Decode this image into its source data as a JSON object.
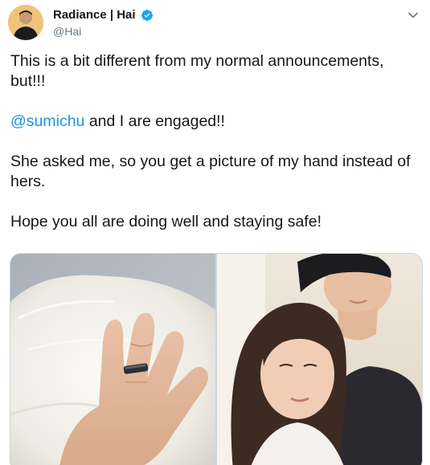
{
  "author": {
    "display_name": "Radiance | Hai",
    "handle": "@Hai",
    "verified": true,
    "avatar": "avatar-photo"
  },
  "tweet": {
    "paragraphs": [
      {
        "text": "This is a bit different from my normal announcements, but!!!"
      },
      {
        "mention": "@sumichu",
        "rest": " and I are engaged!!"
      },
      {
        "text": "She asked me, so you get a picture of my hand instead of hers."
      },
      {
        "text": "Hope you all are doing well and staying safe!"
      }
    ]
  },
  "media": {
    "photos": [
      "hand-with-ring-on-fur-photo",
      "couple-selfie-photo"
    ]
  },
  "icons": {
    "verified": "verified-badge-icon",
    "menu": "chevron-down-icon"
  },
  "colors": {
    "link": "#1b95e0",
    "verified": "#1da1f2",
    "secondary_text": "#657786"
  }
}
